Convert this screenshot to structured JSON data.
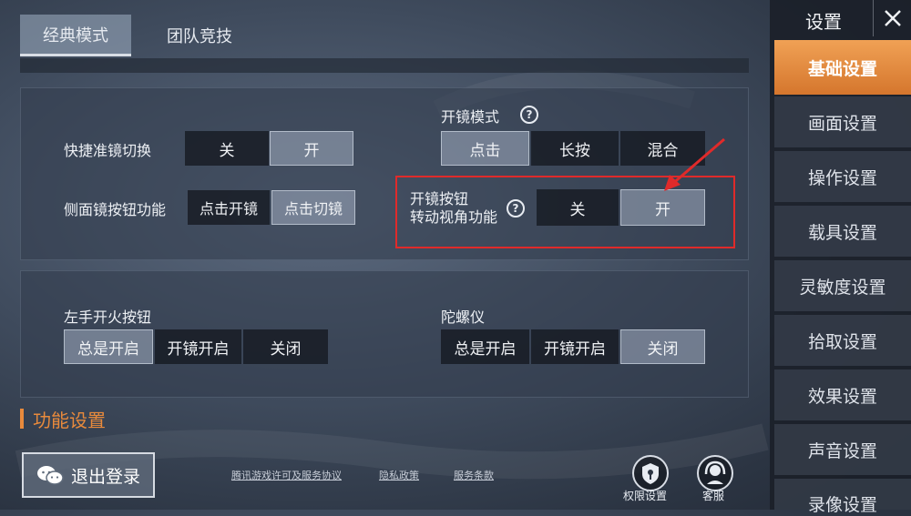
{
  "tabs": [
    "经典模式",
    "团队竞技"
  ],
  "section1": {
    "quick_scope": {
      "label": "快捷准镜切换",
      "options": [
        "关",
        "开"
      ],
      "selected": "开"
    },
    "side_scope": {
      "label": "侧面镜按钮功能",
      "options": [
        "点击开镜",
        "点击切镜"
      ],
      "selected": "点击切镜"
    },
    "scope_mode": {
      "label": "开镜模式",
      "options": [
        "点击",
        "长按",
        "混合"
      ],
      "selected": "点击"
    },
    "scope_turn": {
      "label_line1": "开镜按钮",
      "label_line2": "转动视角功能",
      "options": [
        "关",
        "开"
      ],
      "selected": "开"
    }
  },
  "section2": {
    "left_fire": {
      "label": "左手开火按钮",
      "options": [
        "总是开启",
        "开镜开启",
        "关闭"
      ],
      "selected": "总是开启"
    },
    "gyro": {
      "label": "陀螺仪",
      "options": [
        "总是开启",
        "开镜开启",
        "关闭"
      ],
      "selected": "关闭"
    }
  },
  "section_title": "功能设置",
  "logout_label": "退出登录",
  "footer_links": [
    "腾讯游戏许可及服务协议",
    "隐私政策",
    "服务条款"
  ],
  "bottom_icons": {
    "permission": "权限设置",
    "service": "客服"
  },
  "sidebar": {
    "title": "设置",
    "items": [
      "基础设置",
      "画面设置",
      "操作设置",
      "载具设置",
      "灵敏度设置",
      "拾取设置",
      "效果设置",
      "声音设置",
      "录像设置"
    ],
    "active": "基础设置"
  },
  "colors": {
    "accent": "#e88a3c",
    "highlight": "#e02a2a"
  },
  "question_glyph": "?"
}
